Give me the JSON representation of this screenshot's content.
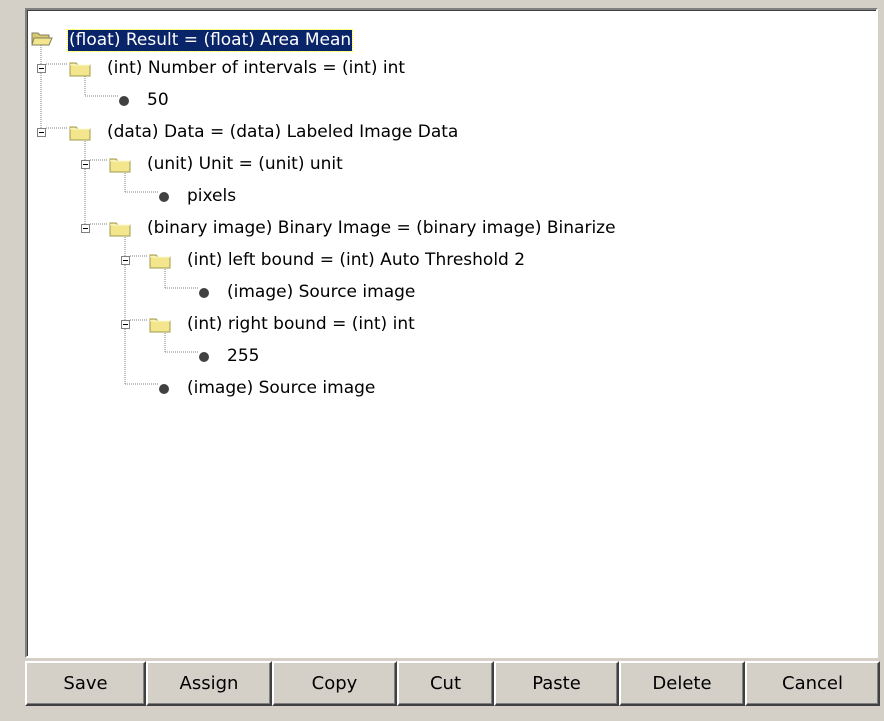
{
  "tree": {
    "nodes": [
      {
        "label": "(float) Result = (float) Area Mean",
        "type": "folder",
        "selected": true
      },
      {
        "label": "(int) Number of intervals = (int) int",
        "type": "folder"
      },
      {
        "label": "50",
        "type": "leaf"
      },
      {
        "label": "(data) Data = (data) Labeled Image Data",
        "type": "folder"
      },
      {
        "label": "(unit) Unit = (unit) unit",
        "type": "folder"
      },
      {
        "label": "pixels",
        "type": "leaf"
      },
      {
        "label": "(binary image) Binary Image = (binary image) Binarize",
        "type": "folder"
      },
      {
        "label": "(int) left bound = (int) Auto Threshold 2",
        "type": "folder"
      },
      {
        "label": "(image) Source image",
        "type": "leaf"
      },
      {
        "label": "(int) right bound = (int) int",
        "type": "folder"
      },
      {
        "label": "255",
        "type": "leaf"
      },
      {
        "label": "(image) Source image",
        "type": "leaf"
      }
    ]
  },
  "buttons": {
    "save": "Save",
    "assign": "Assign",
    "copy": "Copy",
    "cut": "Cut",
    "paste": "Paste",
    "delete": "Delete",
    "cancel": "Cancel"
  },
  "colors": {
    "selection": "#0a246a",
    "folder": "#f4e68c",
    "background": "#d4d0c8"
  },
  "icons": {
    "folder": "folder-icon",
    "leaf": "leaf-dot-icon",
    "collapse": "collapse-box-icon"
  }
}
